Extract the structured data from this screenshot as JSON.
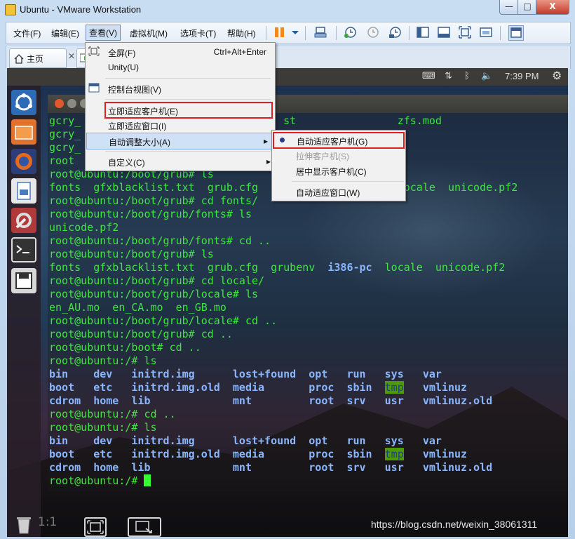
{
  "window": {
    "title": "Ubuntu - VMware Workstation",
    "min": "—",
    "max": "□",
    "close": "X"
  },
  "menubar": [
    {
      "label": "文件(F)"
    },
    {
      "label": "编辑(E)"
    },
    {
      "label": "查看(V)"
    },
    {
      "label": "虚拟机(M)"
    },
    {
      "label": "选项卡(T)"
    },
    {
      "label": "帮助(H)"
    }
  ],
  "tabs": {
    "home": "主页",
    "close": "✕"
  },
  "view_menu": {
    "items": [
      {
        "label": "全屏(F)",
        "shortcut": "Ctrl+Alt+Enter"
      },
      {
        "label": "Unity(U)",
        "shortcut": ""
      },
      {
        "label": "控制台视图(V)",
        "shortcut": ""
      },
      {
        "label": "立即适应客户机(E)",
        "shortcut": ""
      },
      {
        "label": "立即适应窗口(I)",
        "shortcut": ""
      },
      {
        "label": "自动调整大小(A)",
        "shortcut": "▸"
      },
      {
        "label": "自定义(C)",
        "shortcut": "▸"
      }
    ]
  },
  "autosize_menu": {
    "items": [
      {
        "label": "自动适应客户机(G)",
        "checked": true
      },
      {
        "label": "拉伸客户机(S)",
        "disabled": true
      },
      {
        "label": "居中显示客户机(C)"
      },
      {
        "label": "自动适应窗口(W)"
      }
    ]
  },
  "ubuntu": {
    "time": "7:39 PM"
  },
  "terminal": {
    "lines": [
      {
        "parts": [
          {
            "t": "gcry_",
            "c": "g"
          },
          {
            "t": "                                st                zfs.mod",
            "c": "g"
          }
        ]
      },
      {
        "parts": [
          {
            "t": "gcry_",
            "c": "g"
          }
        ]
      },
      {
        "parts": [
          {
            "t": "gcry_",
            "c": "g"
          }
        ]
      },
      {
        "parts": [
          {
            "t": "root",
            "c": "g"
          }
        ]
      },
      {
        "parts": [
          {
            "t": "root@ubuntu:/boot/grub# ls",
            "c": "g"
          }
        ]
      },
      {
        "parts": [
          {
            "t": "fonts  gfxblacklist.txt  grub.cfg",
            "c": "g"
          },
          {
            "t": "                      locale  unicode.pf2",
            "c": "g"
          }
        ]
      },
      {
        "parts": [
          {
            "t": "root@ubuntu:/boot/grub# cd fonts/",
            "c": "g"
          }
        ]
      },
      {
        "parts": [
          {
            "t": "root@ubuntu:/boot/grub/fonts# ls",
            "c": "g"
          }
        ]
      },
      {
        "parts": [
          {
            "t": "unicode.pf2",
            "c": "g"
          }
        ]
      },
      {
        "parts": [
          {
            "t": "root@ubuntu:/boot/grub/fonts# cd ..",
            "c": "g"
          }
        ]
      },
      {
        "parts": [
          {
            "t": "root@ubuntu:/boot/grub# ls",
            "c": "g"
          }
        ]
      },
      {
        "parts": [
          {
            "t": "fonts  gfxblacklist.txt  grub.cfg  grubenv  ",
            "c": "g"
          },
          {
            "t": "i386-pc",
            "c": "b"
          },
          {
            "t": "  locale  unicode.pf2",
            "c": "g"
          }
        ]
      },
      {
        "parts": [
          {
            "t": "root@ubuntu:/boot/grub# cd locale/",
            "c": "g"
          }
        ]
      },
      {
        "parts": [
          {
            "t": "root@ubuntu:/boot/grub/locale# ls",
            "c": "g"
          }
        ]
      },
      {
        "parts": [
          {
            "t": "en_AU.mo  en_CA.mo  en_GB.mo",
            "c": "g"
          }
        ]
      },
      {
        "parts": [
          {
            "t": "root@ubuntu:/boot/grub/locale# cd ..",
            "c": "g"
          }
        ]
      },
      {
        "parts": [
          {
            "t": "root@ubuntu:/boot/grub# cd ..",
            "c": "g"
          }
        ]
      },
      {
        "parts": [
          {
            "t": "root@ubuntu:/boot# cd ..",
            "c": "g"
          }
        ]
      },
      {
        "parts": [
          {
            "t": "root@ubuntu:/# ls",
            "c": "g"
          }
        ]
      },
      {
        "parts": [
          {
            "t": "bin    dev   initrd.img      lost+found  opt   run   sys   var",
            "c": "b"
          }
        ]
      },
      {
        "parts": [
          {
            "t": "boot   etc   initrd.img.old  media       proc  sbin  ",
            "c": "b"
          },
          {
            "t": "tmp",
            "c": "hl"
          },
          {
            "t": "   vmlinuz",
            "c": "b"
          }
        ]
      },
      {
        "parts": [
          {
            "t": "cdrom  home  lib             mnt         root  srv   usr   vmlinuz.old",
            "c": "b"
          }
        ]
      },
      {
        "parts": [
          {
            "t": "root@ubuntu:/# cd ..",
            "c": "g"
          }
        ]
      },
      {
        "parts": [
          {
            "t": "root@ubuntu:/# ls",
            "c": "g"
          }
        ]
      },
      {
        "parts": [
          {
            "t": "bin    dev   initrd.img      lost+found  opt   run   sys   var",
            "c": "b"
          }
        ]
      },
      {
        "parts": [
          {
            "t": "boot   etc   initrd.img.old  media       proc  sbin  ",
            "c": "b"
          },
          {
            "t": "tmp",
            "c": "hl"
          },
          {
            "t": "   vmlinuz",
            "c": "b"
          }
        ]
      },
      {
        "parts": [
          {
            "t": "cdrom  home  lib             mnt         root  srv   usr   vmlinuz.old",
            "c": "b"
          }
        ]
      },
      {
        "parts": [
          {
            "t": "root@ubuntu:/# ",
            "c": "g"
          }
        ]
      }
    ]
  },
  "bottom": {
    "ratio": "1:1",
    "watermark": "https://blog.csdn.net/weixin_38061311"
  }
}
